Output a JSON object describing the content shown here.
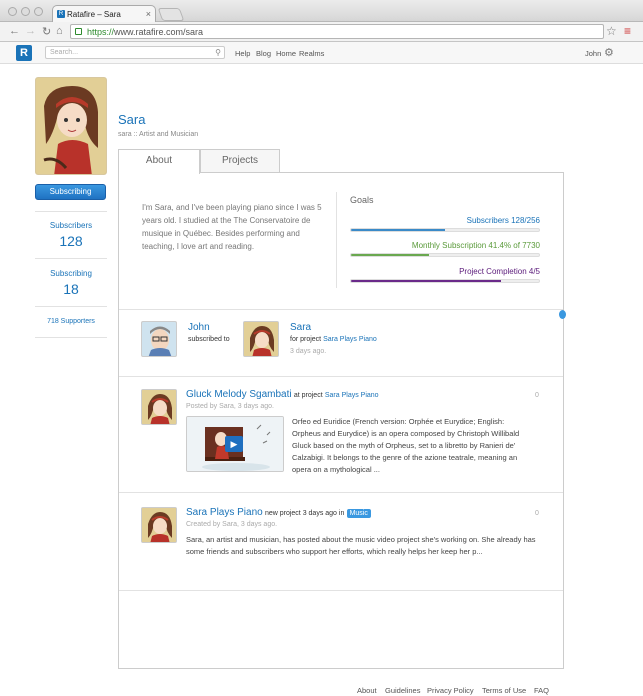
{
  "browser": {
    "tab_title": "Ratafire – Sara",
    "url_scheme": "https://",
    "url_rest": "www.ratafire.com/sara"
  },
  "header": {
    "logo": "R",
    "search_placeholder": "Search...",
    "nav": [
      "Help",
      "Blog",
      "Home",
      "Realms"
    ],
    "user": "John"
  },
  "profile": {
    "name": "Sara",
    "tagline": "sara :: Artist and Musician",
    "subscribe_label": "Subscribing",
    "subscribers_label": "Subscribers",
    "subscribers_count": "128",
    "subscribing_label": "Subscribing",
    "subscribing_count": "18",
    "supporters": "718 Supporters"
  },
  "tabs": [
    "About",
    "Projects"
  ],
  "about": "I'm Sara, and I've been playing piano since I was 5 years old. I studied at the The Conservatoire de musique in Québec. Besides performing and teaching, I love art and reading.",
  "goals": {
    "title": "Goals",
    "items": [
      {
        "label": "Subscribers 128/256",
        "value": 0.5,
        "color": "#3a8ac8",
        "text_color": "#1a73b8"
      },
      {
        "label": "Monthly Subscription 41.4% of 7730",
        "value": 0.414,
        "color": "#6aa84f",
        "text_color": "#5a9a3a"
      },
      {
        "label": "Project Completion 4/5",
        "value": 0.8,
        "color": "#6a2a8a",
        "text_color": "#5a1a7a"
      }
    ]
  },
  "activity": {
    "user1": "John",
    "verb": "subscribed to",
    "user2": "Sara",
    "project_prefix": "for project",
    "project": "Sara Plays Piano",
    "time": "3 days ago."
  },
  "feed": [
    {
      "title": "Gluck Melody Sgambati",
      "prefix": "at project",
      "project": "Sara Plays Piano",
      "meta": "Posted by Sara, 3 days ago.",
      "count": "0",
      "body": "Orfeo ed Euridice (French version: Orphée et Eurydice; English: Orpheus and Eurydice) is an opera composed by Christoph Willibald Gluck based on the myth of Orpheus, set to a libretto by Ranieri de' Calzabigi. It belongs to the genre of the azione teatrale, meaning an opera on a mythological ..."
    },
    {
      "title": "Sara Plays Piano",
      "prefix": "new project 3 days ago in",
      "badge": "Music",
      "meta": "Created by Sara, 3 days ago.",
      "count": "0",
      "body": "Sara, an artist and musician, has posted about the music video project she's working on. She already has some friends and subscribers who support her efforts, which really helps her keep her p..."
    }
  ],
  "footer": [
    "About",
    "Guidelines",
    "Privacy Policy",
    "Terms of Use",
    "FAQ"
  ]
}
